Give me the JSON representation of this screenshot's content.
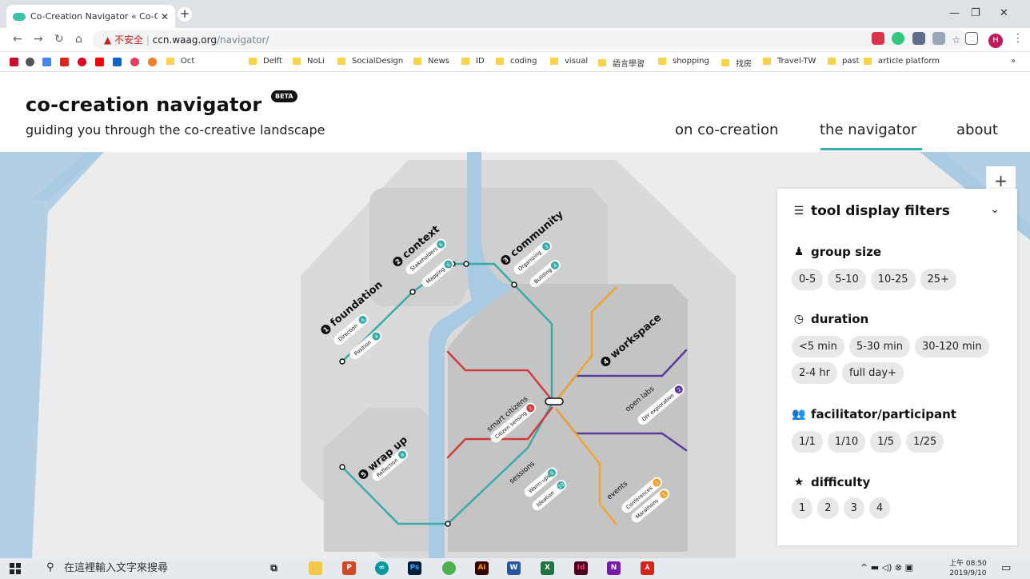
{
  "browser": {
    "tab_title": "Co-Creation Navigator « Co-Cr",
    "url_warning": "▲ 不安全",
    "url_host": "ccn.waag.org",
    "url_path": "/navigator/",
    "profile_initial": "H",
    "bookmarks": [
      "Oct",
      "Delft",
      "NoLi",
      "SocialDesign",
      "News",
      "ID",
      "coding",
      "visual",
      "語言學習",
      "shopping",
      "找房",
      "Travel-TW",
      "past",
      "article platform"
    ]
  },
  "header": {
    "brand": "co-creation navigator",
    "beta": "BETA",
    "tagline": "guiding you through the co-creative landscape",
    "nav": [
      "on co-creation",
      "the navigator",
      "about"
    ]
  },
  "map": {
    "zones": [
      {
        "num": "1",
        "name": "foundation"
      },
      {
        "num": "2",
        "name": "context"
      },
      {
        "num": "3",
        "name": "community"
      },
      {
        "num": "4",
        "name": "workspace"
      },
      {
        "num": "5",
        "name": "wrap up"
      }
    ],
    "tools": [
      {
        "label": "Direction",
        "badge": "6"
      },
      {
        "label": "Position",
        "badge": "4"
      },
      {
        "label": "Stakeholders",
        "badge": "6"
      },
      {
        "label": "Mapping",
        "badge": "6"
      },
      {
        "label": "Organizing",
        "badge": "3"
      },
      {
        "label": "Building",
        "badge": "4"
      },
      {
        "label": "Citizen sensing",
        "badge": "2"
      },
      {
        "label": "DIY exploration",
        "badge": "2"
      },
      {
        "label": "Reflection",
        "badge": "4"
      },
      {
        "label": "Warm-ups",
        "badge": "8"
      },
      {
        "label": "Ideation",
        "badge": "10"
      },
      {
        "label": "Conferences",
        "badge": "1"
      },
      {
        "label": "Marathons",
        "badge": "1"
      }
    ],
    "lines": [
      "smart citizens",
      "open labs",
      "sessions",
      "events"
    ],
    "zoom_button": "+"
  },
  "filters": {
    "title": "tool display filters",
    "group_size": {
      "label": "group size",
      "options": [
        "0-5",
        "5-10",
        "10-25",
        "25+"
      ]
    },
    "duration": {
      "label": "duration",
      "options": [
        "<5 min",
        "5-30 min",
        "30-120 min",
        "2-4 hr",
        "full day+"
      ]
    },
    "ratio": {
      "label": "facilitator/participant",
      "options": [
        "1/1",
        "1/10",
        "1/5",
        "1/25"
      ]
    },
    "difficulty": {
      "label": "difficulty",
      "options": [
        "1",
        "2",
        "3",
        "4"
      ]
    }
  },
  "taskbar": {
    "search_placeholder": "在這裡輸入文字來搜尋",
    "time": "上午 08:50",
    "date": "2019/9/10"
  },
  "colors": {
    "teal": "#3aaba8",
    "red": "#d23b3b",
    "purple": "#5b3c9c",
    "orange": "#f0a32f",
    "river": "#a9cae3"
  }
}
